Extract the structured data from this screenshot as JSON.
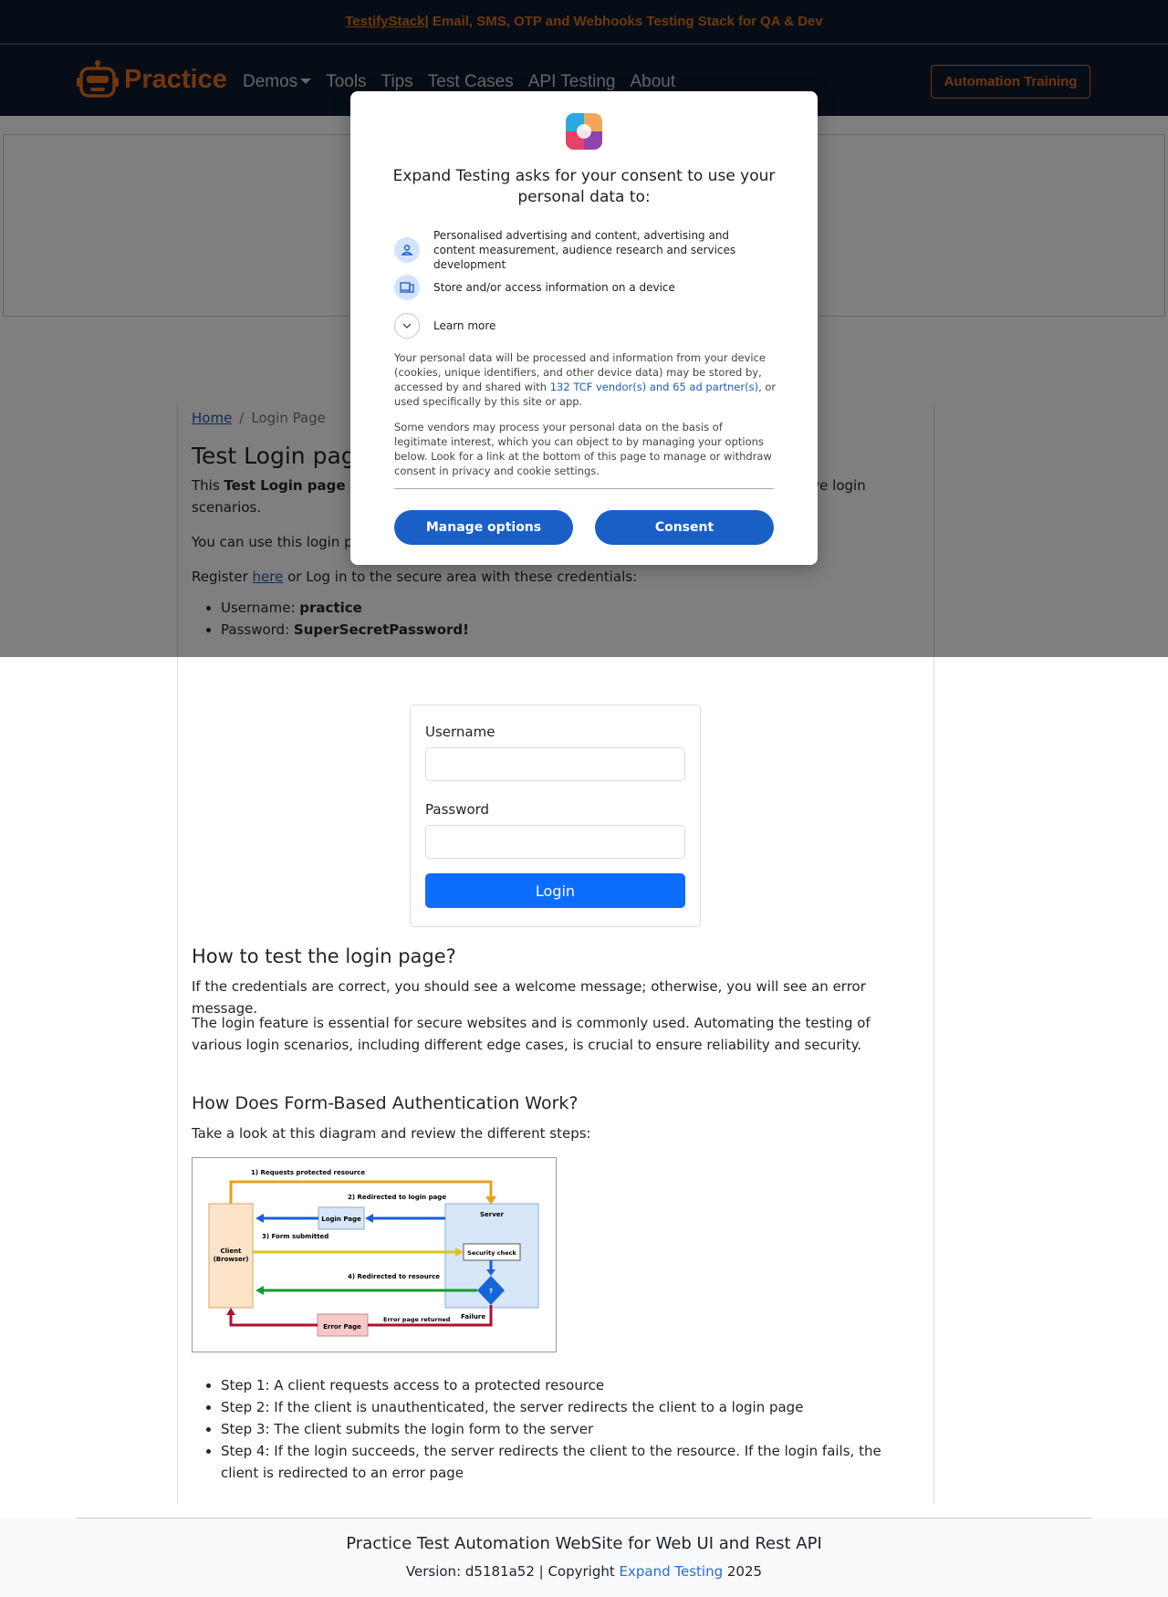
{
  "banner": {
    "link": "TestifyStack",
    "text": " | Email, SMS, OTP and Webhooks Testing Stack for QA & Dev"
  },
  "nav": {
    "brand": "Practice",
    "items": [
      "Demos",
      "Tools",
      "Tips",
      "Test Cases",
      "API Testing",
      "About"
    ],
    "cta": "Automation Training"
  },
  "breadcrumb": {
    "home": "Home",
    "sep": "/",
    "current": "Login Page"
  },
  "page": {
    "title": "Test Login page",
    "intro_prefix": "This ",
    "intro_bold": "Test Login page",
    "intro_rest": " is designed for practicing automation testing of positive and negative login scenarios.",
    "usage": "You can use this login page to practice with Selenium, Playwright, Cypress, etc.",
    "register_prefix": "Register ",
    "register_link": "here",
    "register_suffix": " or Log in to the secure area with these credentials:",
    "cred_user_label": "Username: ",
    "cred_user_value": "practice",
    "cred_pass_label": "Password: ",
    "cred_pass_value": "SuperSecretPassword!"
  },
  "form": {
    "username_label": "Username",
    "username_value": "",
    "password_label": "Password",
    "password_value": "",
    "submit": "Login"
  },
  "howto": {
    "heading": "How to test the login page?",
    "p1": "If the credentials are correct, you should see a welcome message; otherwise, you will see an error message.",
    "p2": "The login feature is essential for secure websites and is commonly used. Automating the testing of various login scenarios, including different edge cases, is crucial to ensure reliability and security."
  },
  "auth": {
    "heading": "How Does Form-Based Authentication Work?",
    "intro": "Take a look at this diagram and review the different steps:",
    "diagram": {
      "l1": "1) Requests protected resource",
      "l2": "2) Redirected to login page",
      "l3": "3) Form submitted",
      "l4": "4) Redirected to resource",
      "login_page": "Login Page",
      "server": "Server",
      "client_a": "Client",
      "client_b": "(Browser)",
      "security": "Security check",
      "q": "?",
      "failure": "Failure",
      "error_page": "Error Page",
      "error_returned": "Error page returned"
    },
    "steps": [
      "Step 1: A client requests access to a protected resource",
      "Step 2: If the client is unauthenticated, the server redirects the client to a login page",
      "Step 3: The client submits the login form to the server",
      "Step 4: If the login succeeds, the server redirects the client to the resource. If the login fails, the client is redirected to an error page"
    ]
  },
  "footer": {
    "title": "Practice Test Automation WebSite for Web UI and Rest API",
    "version_prefix": "Version: d5181a52 | Copyright ",
    "version_link": "Expand Testing",
    "version_suffix": " 2025"
  },
  "consent": {
    "title": "Expand Testing asks for your consent to use your personal data to:",
    "purpose1": "Personalised advertising and content, advertising and content measurement, audience research and services development",
    "purpose2": "Store and/or access information on a device",
    "learn_more": "Learn more",
    "info1_prefix": "Your personal data will be processed and information from your device (cookies, unique identifiers, and other device data) may be stored by, accessed by and shared with ",
    "info1_link": "132 TCF vendor(s) and 65 ad partner(s)",
    "info1_suffix": ", or used specifically by this site or app.",
    "info2": "Some vendors may process your personal data on the basis of legitimate interest, which you can object to by managing your options below. Look for a link at the bottom of this page to manage or withdraw consent in privacy and cookie settings.",
    "manage": "Manage options",
    "accept": "Consent"
  },
  "colors": {
    "navy": "#0f1b2d",
    "orange": "#e46f1b",
    "primary": "#0d6efd",
    "consent_blue": "#1a5fc5"
  },
  "icons": [
    "robot-logo-icon",
    "consent-logo-icon",
    "person-icon",
    "devices-icon",
    "chevron-down-icon"
  ]
}
